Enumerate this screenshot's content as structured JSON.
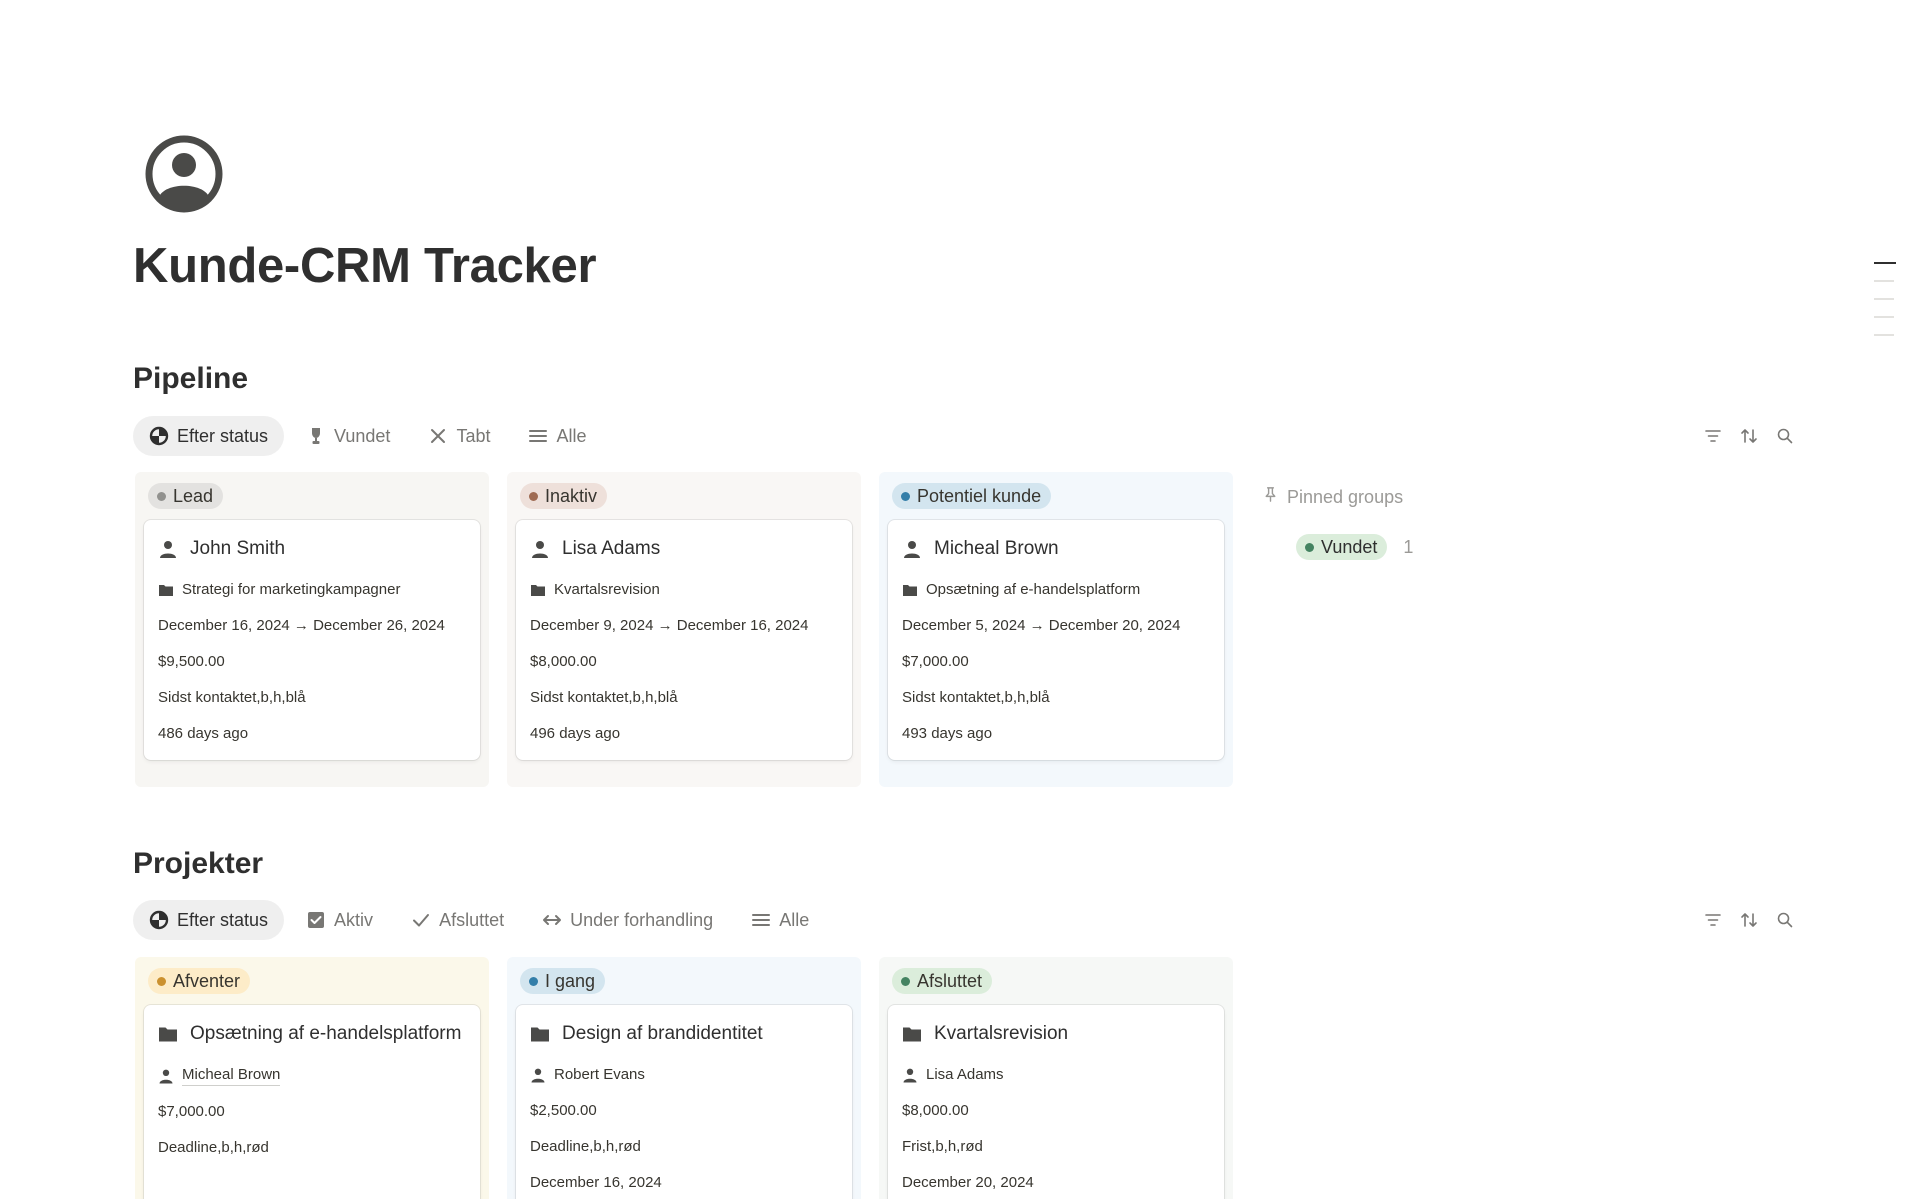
{
  "page": {
    "title": "Kunde-CRM Tracker",
    "icon": "user-circle-icon"
  },
  "colors": {
    "lead_bg": "#f7f6f3",
    "lead_pill": "#e3e2e0",
    "lead_dot": "#91918e",
    "inaktiv_bg": "#f9f7f5",
    "inaktiv_pill": "#eee0da",
    "inaktiv_dot": "#9f6b53",
    "potentiel_bg": "#f3f8fc",
    "potentiel_pill": "#d3e5ef",
    "potentiel_dot": "#337ea9",
    "afventer_bg": "#fbf8ea",
    "afventer_pill": "#fdecc8",
    "afventer_dot": "#cb912f",
    "igang_bg": "#f3f8fc",
    "igang_pill": "#d3e5ef",
    "igang_dot": "#337ea9",
    "afsluttet_bg": "#f6f8f6",
    "afsluttet_pill": "#dbeddb",
    "afsluttet_dot": "#448361"
  },
  "pipeline": {
    "title": "Pipeline",
    "tabs": [
      {
        "label": "Efter status",
        "icon": "status-icon",
        "active": true
      },
      {
        "label": "Vundet",
        "icon": "trophy-icon"
      },
      {
        "label": "Tabt",
        "icon": "x-icon"
      },
      {
        "label": "Alle",
        "icon": "list-icon"
      }
    ],
    "columns": [
      {
        "status": "Lead",
        "cards": [
          {
            "name": "John Smith",
            "project": "Strategi for marketingkampagner",
            "dates": "December 16, 2024 → December 26, 2024",
            "value": "$9,500.00",
            "tag": "Sidst kontaktet,b,h,blå",
            "ago": "486 days ago"
          }
        ]
      },
      {
        "status": "Inaktiv",
        "cards": [
          {
            "name": "Lisa Adams",
            "project": "Kvartalsrevision",
            "dates": "December 9, 2024 → December 16, 2024",
            "value": "$8,000.00",
            "tag": "Sidst kontaktet,b,h,blå",
            "ago": "496 days ago"
          }
        ]
      },
      {
        "status": "Potentiel kunde",
        "cards": [
          {
            "name": "Micheal Brown",
            "project": "Opsætning af e-handelsplatform",
            "dates": "December 5, 2024 → December 20, 2024",
            "value": "$7,000.00",
            "tag": "Sidst kontaktet,b,h,blå",
            "ago": "493 days ago"
          }
        ]
      }
    ],
    "pinned": {
      "label": "Pinned groups",
      "groups": [
        {
          "status": "Vundet",
          "count": "1"
        }
      ]
    }
  },
  "projekter": {
    "title": "Projekter",
    "tabs": [
      {
        "label": "Efter status",
        "icon": "status-icon",
        "active": true
      },
      {
        "label": "Aktiv",
        "icon": "checkbox-icon"
      },
      {
        "label": "Afsluttet",
        "icon": "check-icon"
      },
      {
        "label": "Under forhandling",
        "icon": "arrows-horizontal-icon"
      },
      {
        "label": "Alle",
        "icon": "list-icon"
      }
    ],
    "columns": [
      {
        "status": "Afventer",
        "cards": [
          {
            "name": "Opsætning af e-handelsplatform",
            "client": "Micheal Brown",
            "value": "$7,000.00",
            "tag": "Deadline,b,h,rød"
          }
        ]
      },
      {
        "status": "I gang",
        "cards": [
          {
            "name": "Design af brandidentitet",
            "client": "Robert Evans",
            "value": "$2,500.00",
            "tag": "Deadline,b,h,rød",
            "date": "December 16, 2024"
          }
        ]
      },
      {
        "status": "Afsluttet",
        "cards": [
          {
            "name": "Kvartalsrevision",
            "client": "Lisa Adams",
            "value": "$8,000.00",
            "tag": "Frist,b,h,rød",
            "date": "December 20, 2024"
          }
        ]
      }
    ]
  }
}
